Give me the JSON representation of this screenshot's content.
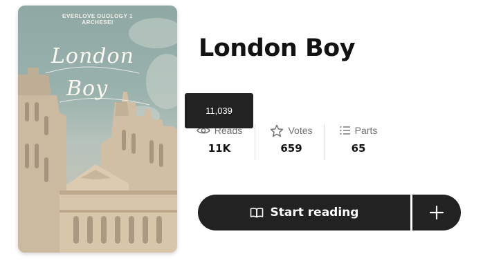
{
  "cover": {
    "series": "EVERLOVE DUOLOGY 1",
    "author": "ARCHESEI",
    "title_line1": "London",
    "title_line2": "Boy"
  },
  "book": {
    "title": "London Boy"
  },
  "stats": {
    "reads": {
      "label": "Reads",
      "value": "11K",
      "icon": "eye-icon"
    },
    "votes": {
      "label": "Votes",
      "value": "659",
      "icon": "star-icon"
    },
    "parts": {
      "label": "Parts",
      "value": "65",
      "icon": "list-icon"
    }
  },
  "tooltip": {
    "text": "11,039"
  },
  "actions": {
    "start_label": "Start reading",
    "start_icon": "book-open-icon",
    "add_icon": "plus-icon"
  },
  "colors": {
    "button_bg": "#222222",
    "tooltip_bg": "#222222",
    "text": "#121212",
    "muted": "#6f6f6f"
  }
}
